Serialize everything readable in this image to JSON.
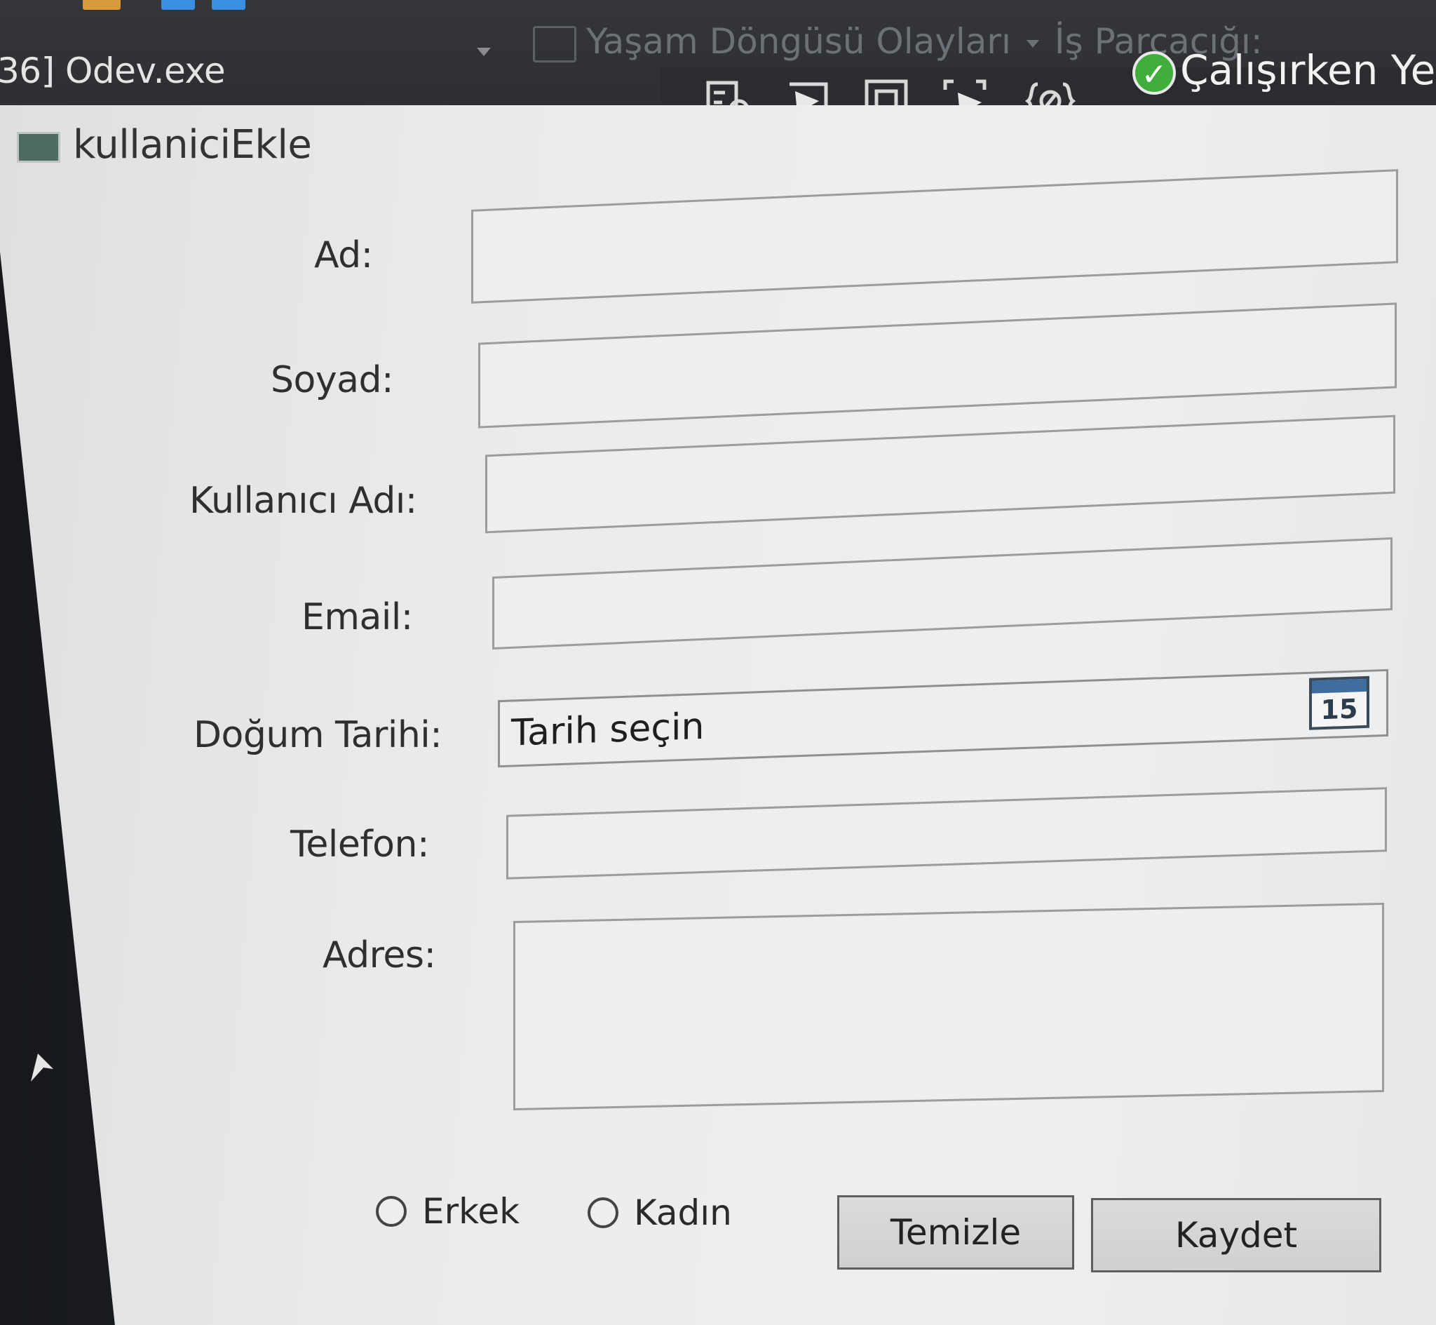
{
  "ide": {
    "process": "36] Odev.exe",
    "lifecycle_events": "Yaşam Döngüsü Olayları",
    "thread": "İş Parçacığı:",
    "hot_reload": "Çalışırken Yeni"
  },
  "window": {
    "title": "kullaniciEkle"
  },
  "form": {
    "ad_label": "Ad:",
    "soyad_label": "Soyad:",
    "kullanici_adi_label": "Kullanıcı Adı:",
    "email_label": "Email:",
    "dogum_tarihi_label": "Doğum Tarihi:",
    "date_placeholder": "Tarih seçin",
    "calendar_day": "15",
    "telefon_label": "Telefon:",
    "adres_label": "Adres:",
    "ad_value": "",
    "soyad_value": "",
    "kullanici_adi_value": "",
    "email_value": "",
    "telefon_value": "",
    "adres_value": ""
  },
  "gender": {
    "male_label": "Erkek",
    "female_label": "Kadın"
  },
  "buttons": {
    "clear_label": "Temizle",
    "save_label": "Kaydet"
  }
}
